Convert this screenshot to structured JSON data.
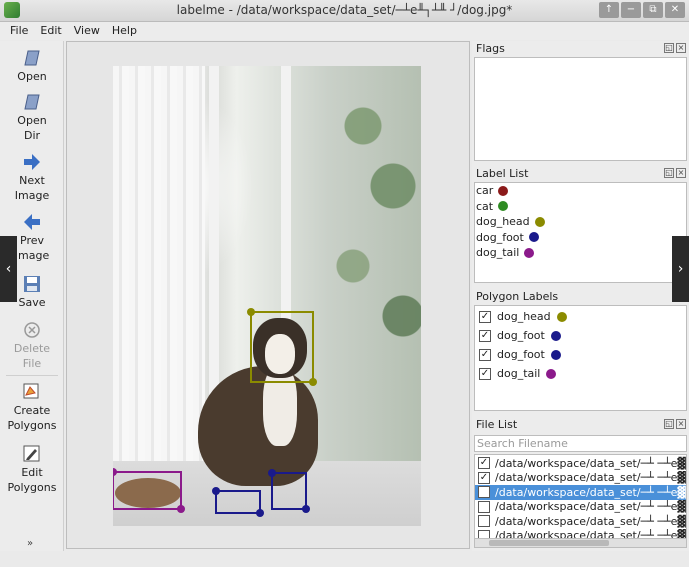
{
  "window": {
    "title": "labelme - /data/workspace/data_set/─┴e╨┐┴╨ ┘/dog.jpg*",
    "buttons": [
      "↑",
      "−",
      "⧉",
      "✕"
    ]
  },
  "menu": {
    "file": "File",
    "edit": "Edit",
    "view": "View",
    "help": "Help"
  },
  "toolbar": {
    "open": "Open",
    "open_dir_1": "Open",
    "open_dir_2": "Dir",
    "next_1": "Next",
    "next_2": "Image",
    "prev_1": "Prev",
    "prev_2": "Image",
    "save": "Save",
    "delete_1": "Delete",
    "delete_2": "File",
    "create_1": "Create",
    "create_2": "Polygons",
    "edit_1": "Edit",
    "edit_2": "Polygons",
    "more": "»"
  },
  "flags": {
    "title": "Flags"
  },
  "label_list": {
    "title": "Label List",
    "items": [
      {
        "label": "car",
        "color": "#8b1a1a"
      },
      {
        "label": "cat",
        "color": "#2e8b22"
      },
      {
        "label": "dog_head",
        "color": "#8b8b00"
      },
      {
        "label": "dog_foot",
        "color": "#1a1a8b"
      },
      {
        "label": "dog_tail",
        "color": "#8b1a8b"
      }
    ]
  },
  "polygon_labels": {
    "title": "Polygon Labels",
    "items": [
      {
        "label": "dog_head",
        "color": "#8b8b00",
        "checked": true
      },
      {
        "label": "dog_foot",
        "color": "#1a1a8b",
        "checked": true
      },
      {
        "label": "dog_foot",
        "color": "#1a1a8b",
        "checked": true
      },
      {
        "label": "dog_tail",
        "color": "#8b1a8b",
        "checked": true
      }
    ]
  },
  "file_list": {
    "title": "File List",
    "search_placeholder": "Search Filename",
    "items": [
      {
        "path": "/data/workspace/data_set/─┴ ─┴e▓",
        "checked": true,
        "selected": false
      },
      {
        "path": "/data/workspace/data_set/─┴ ─┴e▓",
        "checked": true,
        "selected": false
      },
      {
        "path": "/data/workspace/data_set/─┴ ─┴e▓",
        "checked": false,
        "selected": true
      },
      {
        "path": "/data/workspace/data_set/─┴ ─┴e▓",
        "checked": false,
        "selected": false
      },
      {
        "path": "/data/workspace/data_set/─┴ ─┴e▓",
        "checked": false,
        "selected": false
      },
      {
        "path": "/data/workspace/data_set/─┴ ─┴e▓",
        "checked": false,
        "selected": false
      }
    ]
  },
  "panel_button_icons": [
    "float-icon",
    "close-icon"
  ],
  "nav_arrows": {
    "left": "‹",
    "right": "›"
  }
}
